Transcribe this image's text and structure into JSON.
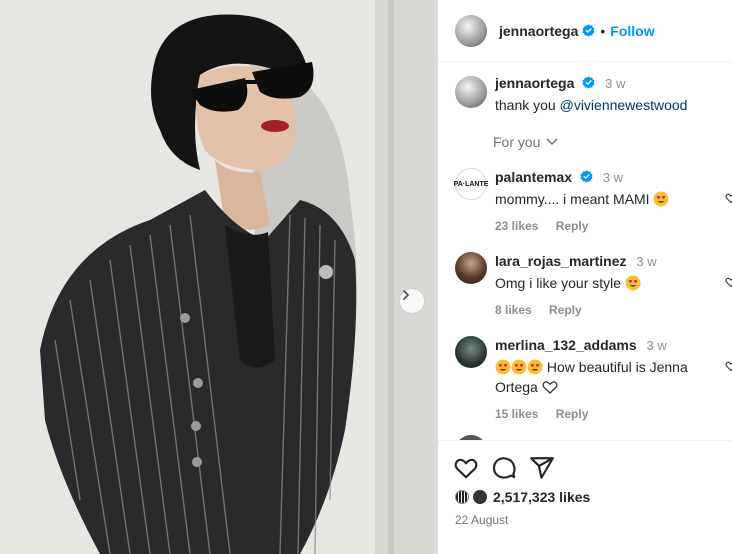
{
  "post": {
    "username": "jennaortega",
    "follow_label": "Follow",
    "caption_time": "3 w",
    "caption_text": "thank you ",
    "caption_mention": "@viviennewestwood",
    "for_you_label": "For you"
  },
  "comments": [
    {
      "user": "palantemax",
      "time": "3 w",
      "text": "mommy.... i meant MAMI",
      "emoji": "heart-eyes",
      "likes": "23 likes",
      "reply": "Reply",
      "verified": true
    },
    {
      "user": "lara_rojas_martinez",
      "time": "3 w",
      "text": "Omg i like your style",
      "emoji": "heart-eyes",
      "likes": "8 likes",
      "reply": "Reply",
      "verified": false
    },
    {
      "user": "merlina_132_addams",
      "time": "3 w",
      "text": "How beautiful is Jenna Ortega",
      "emoji": "heart-eyes",
      "likes": "15 likes",
      "reply": "Reply",
      "verified": false
    }
  ],
  "footer": {
    "likes": "2,517,323 likes",
    "date": "22 August"
  },
  "colors": {
    "accent": "#0095f6",
    "text": "#262626",
    "muted": "#8e8e8e"
  },
  "icons": [
    "verified-badge-icon",
    "chevron-down-icon",
    "heart-icon",
    "comment-icon",
    "share-icon",
    "next-arrow-icon"
  ]
}
